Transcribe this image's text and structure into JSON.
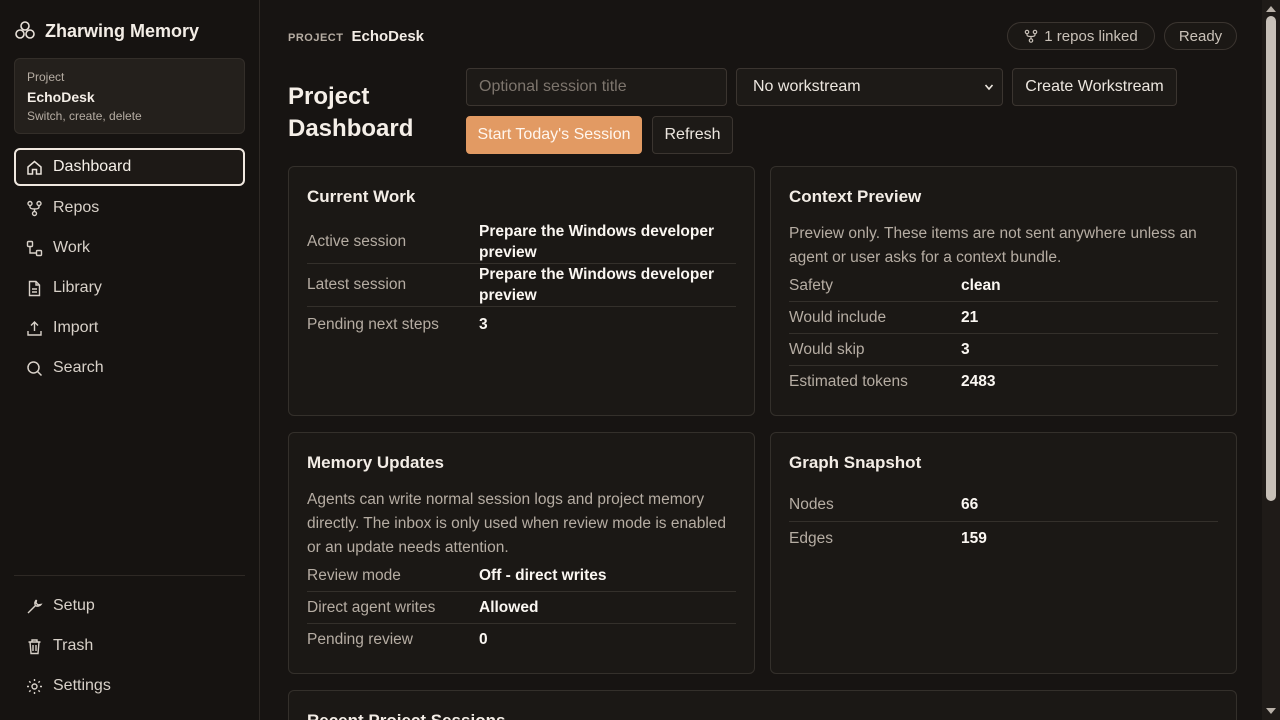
{
  "app": {
    "name": "Zharwing Memory"
  },
  "sidebar": {
    "project": {
      "label": "Project",
      "name": "EchoDesk",
      "hint": "Switch, create, delete"
    },
    "nav": [
      {
        "label": "Dashboard",
        "icon": "home-icon"
      },
      {
        "label": "Repos",
        "icon": "repo-branch-icon"
      },
      {
        "label": "Work",
        "icon": "workflow-icon"
      },
      {
        "label": "Library",
        "icon": "document-icon"
      },
      {
        "label": "Import",
        "icon": "upload-icon"
      },
      {
        "label": "Search",
        "icon": "search-icon"
      }
    ],
    "bottom_nav": [
      {
        "label": "Setup",
        "icon": "wrench-icon"
      },
      {
        "label": "Trash",
        "icon": "trash-icon"
      },
      {
        "label": "Settings",
        "icon": "gear-icon"
      }
    ]
  },
  "header": {
    "project_label": "PROJECT",
    "project_name": "EchoDesk",
    "repos_linked": "1 repos linked",
    "status": "Ready"
  },
  "toolbar": {
    "page_title": "Project Dashboard",
    "session_title_placeholder": "Optional session title",
    "workstream_selected": "No workstream",
    "create_workstream_label": "Create Workstream",
    "start_session_label": "Start Today's Session",
    "refresh_label": "Refresh"
  },
  "current_work": {
    "title": "Current Work",
    "rows": [
      {
        "key": "Active session",
        "value": "Prepare the Windows developer preview"
      },
      {
        "key": "Latest session",
        "value": "Prepare the Windows developer preview"
      },
      {
        "key": "Pending next steps",
        "value": "3"
      }
    ]
  },
  "context_preview": {
    "title": "Context Preview",
    "description": "Preview only. These items are not sent anywhere unless an agent or user asks for a context bundle.",
    "rows": [
      {
        "key": "Safety",
        "value": "clean"
      },
      {
        "key": "Would include",
        "value": "21"
      },
      {
        "key": "Would skip",
        "value": "3"
      },
      {
        "key": "Estimated tokens",
        "value": "2483"
      }
    ]
  },
  "memory_updates": {
    "title": "Memory Updates",
    "description": "Agents can write normal session logs and project memory directly. The inbox is only used when review mode is enabled or an update needs attention.",
    "rows": [
      {
        "key": "Review mode",
        "value": "Off - direct writes"
      },
      {
        "key": "Direct agent writes",
        "value": "Allowed"
      },
      {
        "key": "Pending review",
        "value": "0"
      }
    ]
  },
  "graph_snapshot": {
    "title": "Graph Snapshot",
    "rows": [
      {
        "key": "Nodes",
        "value": "66"
      },
      {
        "key": "Edges",
        "value": "159"
      }
    ]
  },
  "recent_sessions": {
    "title": "Recent Project Sessions"
  }
}
